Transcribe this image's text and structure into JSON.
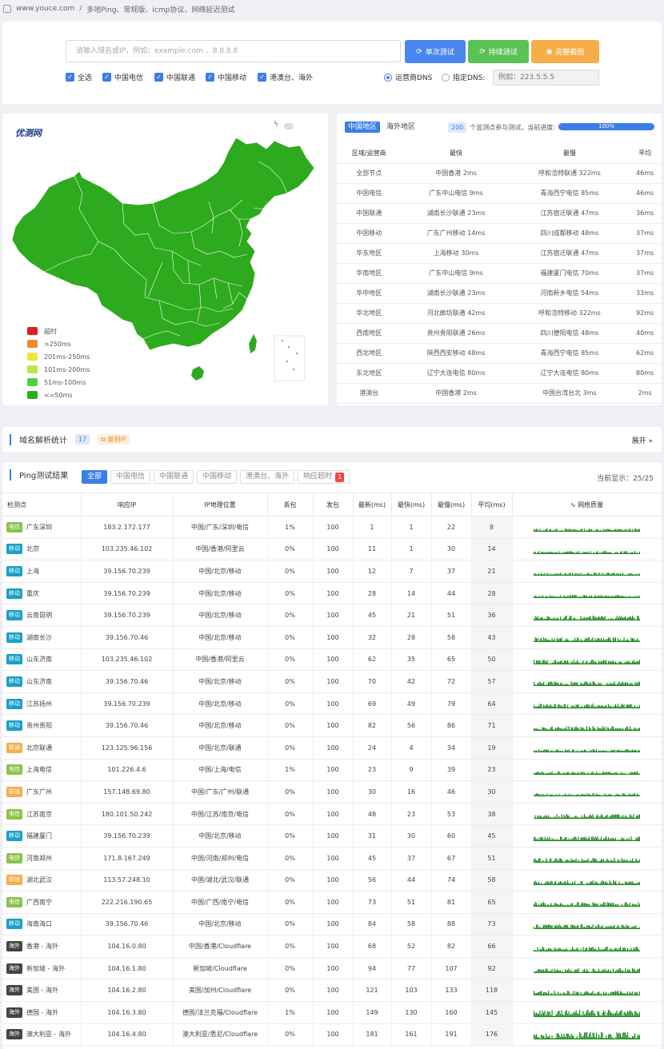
{
  "breadcrumb": {
    "site": "www.youce.com",
    "sep": "/",
    "page": "多地Ping、常规版、icmp协议、网络延迟测试"
  },
  "search": {
    "placeholder": "请输入域名或IP，例如：example.com 、8.8.8.8"
  },
  "buttons": {
    "single": "单次测试",
    "continuous": "持续测试",
    "screenshot": "完整截图"
  },
  "colors": {
    "single": "#4a86f0",
    "continuous": "#5bc254",
    "screenshot": "#f6ad4a",
    "telecom": "#8bc34a",
    "mobile": "#1aa0c8",
    "unicom": "#f6ad4a",
    "overseas": "#444444",
    "qual": "#1e8a1e",
    "map": "#2eaa1e"
  },
  "filters": [
    "全选",
    "中国电信",
    "中国联通",
    "中国移动",
    "港澳台、海外"
  ],
  "dns": {
    "option1": "运营商DNS",
    "option2": "指定DNS:",
    "placeholder": "例如：223.5.5.5"
  },
  "map": {
    "logo": "优测网",
    "legend": [
      {
        "label": "超时",
        "color": "#dd1f1f"
      },
      {
        "label": ">250ms",
        "color": "#ef8a2e"
      },
      {
        "label": "201ms-250ms",
        "color": "#f2e33a"
      },
      {
        "label": "101ms-200ms",
        "color": "#b9e64d"
      },
      {
        "label": "51ms-100ms",
        "color": "#4fd13d"
      },
      {
        "label": "<=50ms",
        "color": "#2eaa1e"
      }
    ]
  },
  "stats": {
    "tab1": "中国地区",
    "tab2": "海外地区",
    "count": "200",
    "count_text": "个监测点参与测试，当前进度:",
    "progress": "100%",
    "progress_value": 100,
    "headers": [
      "区域/运营商",
      "最快",
      "最慢",
      "平均"
    ],
    "rows": [
      [
        "全部节点",
        "中国香港 2ms",
        "呼和浩特联通 322ms",
        "46ms"
      ],
      [
        "中国电信",
        "广东中山电信 9ms",
        "青海西宁电信 85ms",
        "46ms"
      ],
      [
        "中国联通",
        "湖南长沙联通 23ms",
        "江苏宿迁联通 47ms",
        "36ms"
      ],
      [
        "中国移动",
        "广东广州移动 14ms",
        "四川成都移动 48ms",
        "37ms"
      ],
      [
        "华东地区",
        "上海移动 30ms",
        "江苏宿迁联通 47ms",
        "37ms"
      ],
      [
        "华南地区",
        "广东中山电信 9ms",
        "福建厦门电信 70ms",
        "37ms"
      ],
      [
        "华中地区",
        "湖南长沙联通 23ms",
        "河南新乡电信 54ms",
        "33ms"
      ],
      [
        "华北地区",
        "河北廊坊联通 42ms",
        "呼和浩特移动 322ms",
        "92ms"
      ],
      [
        "西南地区",
        "贵州贵阳联通 26ms",
        "四川德阳电信 48ms",
        "40ms"
      ],
      [
        "西北地区",
        "陕西西安移动 48ms",
        "青海西宁电信 85ms",
        "62ms"
      ],
      [
        "东北地区",
        "辽宁大连电信 80ms",
        "辽宁大连电信 80ms",
        "80ms"
      ],
      [
        "港澳台",
        "中国香港 2ms",
        "中国台湾台北 3ms",
        "2ms"
      ]
    ]
  },
  "dns_stats": {
    "title": "域名解析统计",
    "count": "17",
    "copy": "复制IP",
    "expand": "展开"
  },
  "ping": {
    "title": "Ping测试结果",
    "tabs": [
      "全部",
      "中国电信",
      "中国联通",
      "中国移动",
      "港澳台、海外",
      "响应超时"
    ],
    "timeout_count": "1",
    "shown_label": "当前显示：25/25",
    "headers": [
      "检测点",
      "响应IP",
      "IP地理位置",
      "丢包",
      "发包",
      "最新(ms)",
      "最快(ms)",
      "最慢(ms)",
      "平均(ms)",
      "网络质量"
    ],
    "rows": [
      [
        "电信",
        "广东深圳",
        "183.2.172.177",
        "中国/广东/深圳/电信",
        "1%",
        "100",
        "1",
        "1",
        "22",
        "8"
      ],
      [
        "移动",
        "北京",
        "103.235.46.102",
        "中国/香港/阿里云",
        "0%",
        "100",
        "11",
        "1",
        "30",
        "14"
      ],
      [
        "移动",
        "上海",
        "39.156.70.239",
        "中国/北京/移动",
        "0%",
        "100",
        "12",
        "7",
        "37",
        "21"
      ],
      [
        "移动",
        "重庆",
        "39.156.70.239",
        "中国/北京/移动",
        "0%",
        "100",
        "28",
        "14",
        "44",
        "28"
      ],
      [
        "移动",
        "云南昆明",
        "39.156.70.239",
        "中国/北京/移动",
        "0%",
        "100",
        "45",
        "21",
        "51",
        "36"
      ],
      [
        "移动",
        "湖南长沙",
        "39.156.70.46",
        "中国/北京/移动",
        "0%",
        "100",
        "32",
        "28",
        "58",
        "43"
      ],
      [
        "移动",
        "山东济南",
        "103.235.46.102",
        "中国/香港/阿里云",
        "0%",
        "100",
        "62",
        "35",
        "65",
        "50"
      ],
      [
        "移动",
        "山东济南",
        "39.156.70.46",
        "中国/北京/移动",
        "0%",
        "100",
        "70",
        "42",
        "72",
        "57"
      ],
      [
        "移动",
        "江苏扬州",
        "39.156.70.239",
        "中国/北京/移动",
        "0%",
        "100",
        "69",
        "49",
        "79",
        "64"
      ],
      [
        "移动",
        "贵州贵阳",
        "39.156.70.46",
        "中国/北京/移动",
        "0%",
        "100",
        "82",
        "56",
        "86",
        "71"
      ],
      [
        "联通",
        "北京联通",
        "123.125.96.156",
        "中国/北京/联通",
        "0%",
        "100",
        "24",
        "4",
        "34",
        "19"
      ],
      [
        "电信",
        "上海电信",
        "101.226.4.6",
        "中国/上海/电信",
        "1%",
        "100",
        "23",
        "9",
        "39",
        "23"
      ],
      [
        "联通",
        "广东广州",
        "157.148.69.80",
        "中国/广东/广州/联通",
        "0%",
        "100",
        "30",
        "16",
        "46",
        "30"
      ],
      [
        "电信",
        "江苏南京",
        "180.101.50.242",
        "中国/江苏/南京/电信",
        "0%",
        "100",
        "48",
        "23",
        "53",
        "38"
      ],
      [
        "移动",
        "福建厦门",
        "39.156.70.239",
        "中国/北京/移动",
        "0%",
        "100",
        "31",
        "30",
        "60",
        "45"
      ],
      [
        "电信",
        "河南郑州",
        "171.8.167.249",
        "中国/河南/郑州/电信",
        "0%",
        "100",
        "45",
        "37",
        "67",
        "51"
      ],
      [
        "联通",
        "湖北武汉",
        "113.57.248.10",
        "中国/湖北/武汉/联通",
        "0%",
        "100",
        "56",
        "44",
        "74",
        "58"
      ],
      [
        "电信",
        "广西南宁",
        "222.216.190.65",
        "中国/广西/南宁/电信",
        "0%",
        "100",
        "73",
        "51",
        "81",
        "65"
      ],
      [
        "移动",
        "海南海口",
        "39.156.70.46",
        "中国/北京/移动",
        "0%",
        "100",
        "84",
        "58",
        "88",
        "73"
      ],
      [
        "海外",
        "香港 - 海外",
        "104.16.0.80",
        "中国/香港/Cloudflare",
        "0%",
        "100",
        "68",
        "52",
        "82",
        "66"
      ],
      [
        "海外",
        "新加坡 - 海外",
        "104.16.1.80",
        "新加坡/Cloudflare",
        "0%",
        "100",
        "94",
        "77",
        "107",
        "92"
      ],
      [
        "海外",
        "美国 - 海外",
        "104.16.2.80",
        "美国/加州/Cloudflare",
        "0%",
        "100",
        "121",
        "103",
        "133",
        "118"
      ],
      [
        "海外",
        "德国 - 海外",
        "104.16.3.80",
        "德国/法兰克福/Cloudflare",
        "1%",
        "100",
        "149",
        "130",
        "160",
        "145"
      ],
      [
        "海外",
        "澳大利亚 - 海外",
        "104.16.4.80",
        "澳大利亚/悉尼/Cloudflare",
        "0%",
        "100",
        "181",
        "161",
        "191",
        "176"
      ]
    ]
  }
}
